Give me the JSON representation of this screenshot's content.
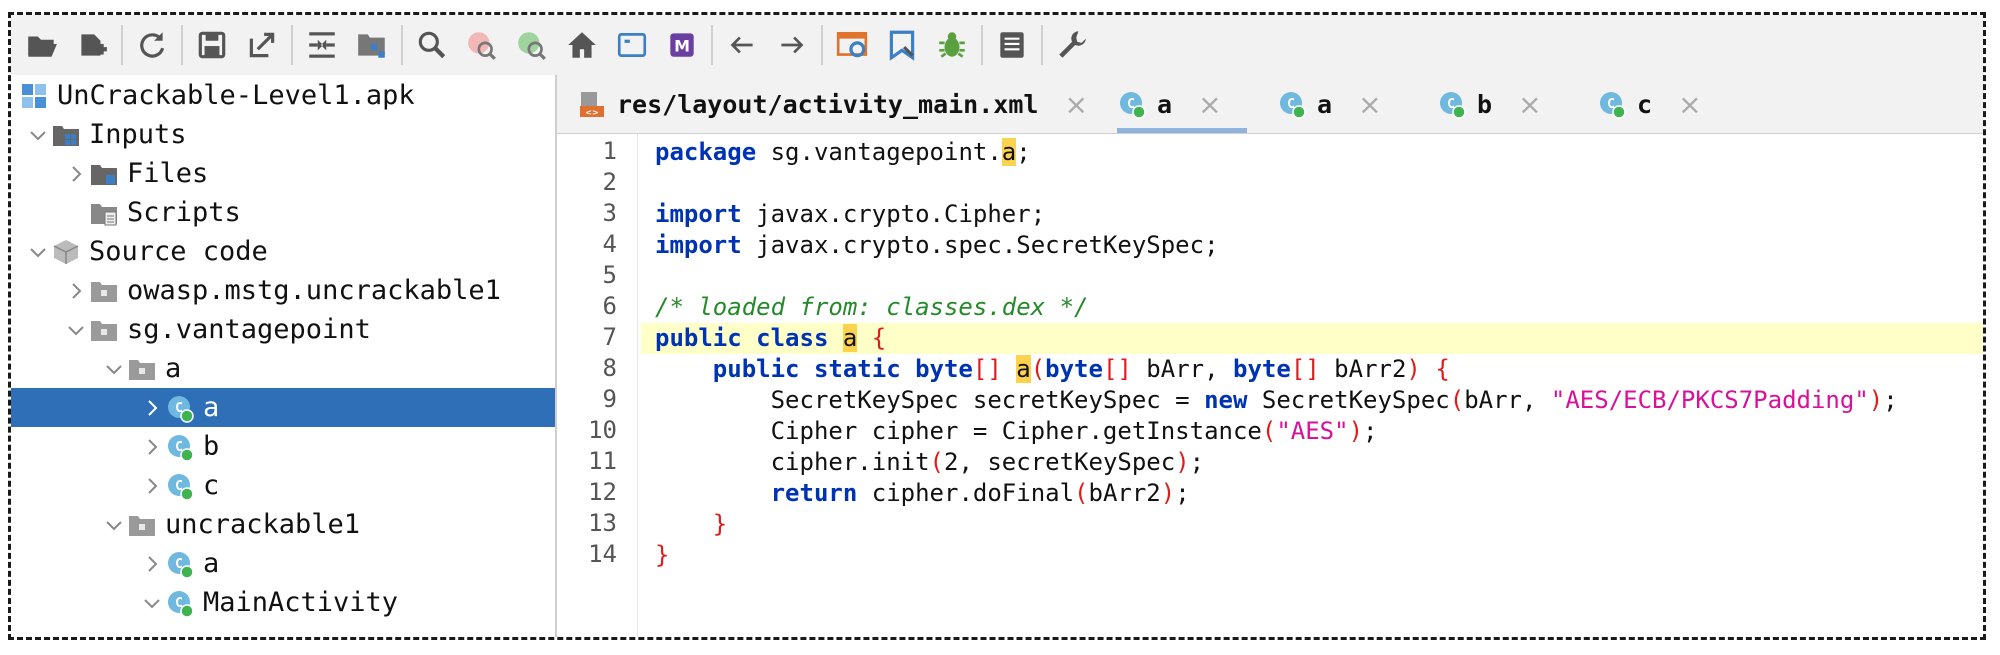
{
  "toolbar": {
    "buttons": [
      {
        "name": "open-file-icon"
      },
      {
        "name": "add-files-icon"
      },
      "sep",
      {
        "name": "reload-icon"
      },
      "sep",
      {
        "name": "save-icon"
      },
      {
        "name": "export-icon"
      },
      "sep",
      {
        "name": "sync-tree-icon"
      },
      {
        "name": "flatten-packages-icon"
      },
      "sep",
      {
        "name": "search-icon"
      },
      {
        "name": "find-class-icon"
      },
      {
        "name": "find-usage-icon"
      },
      {
        "name": "home-icon"
      },
      {
        "name": "log-viewer-icon"
      },
      {
        "name": "smali-icon"
      },
      "sep",
      {
        "name": "back-arrow-icon"
      },
      {
        "name": "forward-arrow-icon"
      },
      "sep",
      {
        "name": "deobfuscation-icon"
      },
      {
        "name": "quark-icon"
      },
      {
        "name": "debug-bug-icon"
      },
      "sep",
      {
        "name": "log-list-icon"
      },
      "sep",
      {
        "name": "wrench-settings-icon"
      }
    ]
  },
  "tree": {
    "rows": [
      {
        "label": "UnCrackable-Level1.apk",
        "indent": 0,
        "chev": "none",
        "icon": "apk",
        "selected": false
      },
      {
        "label": "Inputs",
        "indent": 0,
        "chev": "down",
        "icon": "inputs",
        "selected": false
      },
      {
        "label": "Files",
        "indent": 1,
        "chev": "right",
        "icon": "folder-dark",
        "selected": false
      },
      {
        "label": "Scripts",
        "indent": 1,
        "chev": "none",
        "icon": "scripts",
        "selected": false
      },
      {
        "label": "Source code",
        "indent": 0,
        "chev": "down",
        "icon": "box",
        "selected": false
      },
      {
        "label": "owasp.mstg.uncrackable1",
        "indent": 1,
        "chev": "right",
        "icon": "package",
        "selected": false
      },
      {
        "label": "sg.vantagepoint",
        "indent": 1,
        "chev": "down",
        "icon": "package",
        "selected": false
      },
      {
        "label": "a",
        "indent": 2,
        "chev": "down",
        "icon": "package",
        "selected": false
      },
      {
        "label": "a",
        "indent": 3,
        "chev": "right",
        "icon": "class",
        "selected": true
      },
      {
        "label": "b",
        "indent": 3,
        "chev": "right",
        "icon": "class",
        "selected": false
      },
      {
        "label": "c",
        "indent": 3,
        "chev": "right",
        "icon": "class",
        "selected": false
      },
      {
        "label": "uncrackable1",
        "indent": 2,
        "chev": "down",
        "icon": "package",
        "selected": false
      },
      {
        "label": "a",
        "indent": 3,
        "chev": "right",
        "icon": "class",
        "selected": false
      },
      {
        "label": "MainActivity",
        "indent": 3,
        "chev": "down",
        "icon": "class",
        "selected": false
      }
    ]
  },
  "tabs": [
    {
      "label": "res/layout/activity_main.xml",
      "icon": "xml",
      "active": false,
      "close": "×"
    },
    {
      "label": "a",
      "icon": "class",
      "active": true,
      "close": "×"
    },
    {
      "label": "a",
      "icon": "class",
      "active": false,
      "close": "×"
    },
    {
      "label": "b",
      "icon": "class",
      "active": false,
      "close": "×"
    },
    {
      "label": "c",
      "icon": "class",
      "active": false,
      "close": "×"
    }
  ],
  "editor": {
    "highlight_line": 7,
    "lines": [
      [
        [
          "kw",
          "package"
        ],
        [
          "t",
          " sg.vantagepoint."
        ],
        [
          "mark",
          "a"
        ],
        [
          "t",
          ";"
        ]
      ],
      [],
      [
        [
          "kw",
          "import"
        ],
        [
          "t",
          " javax.crypto.Cipher;"
        ]
      ],
      [
        [
          "kw",
          "import"
        ],
        [
          "t",
          " javax.crypto.spec.SecretKeySpec;"
        ]
      ],
      [],
      [
        [
          "cm",
          "/* loaded from: classes.dex */"
        ]
      ],
      [
        [
          "kw",
          "public class "
        ],
        [
          "mark",
          "a"
        ],
        [
          "t",
          " "
        ],
        [
          "br",
          "{"
        ]
      ],
      [
        [
          "t",
          "    "
        ],
        [
          "kw",
          "public static byte"
        ],
        [
          "br",
          "[]"
        ],
        [
          "t",
          " "
        ],
        [
          "mark",
          "a"
        ],
        [
          "br",
          "("
        ],
        [
          "kw",
          "byte"
        ],
        [
          "br",
          "[]"
        ],
        [
          "t",
          " bArr, "
        ],
        [
          "kw",
          "byte"
        ],
        [
          "br",
          "[]"
        ],
        [
          "t",
          " bArr2"
        ],
        [
          "br",
          ")"
        ],
        [
          "t",
          " "
        ],
        [
          "br",
          "{"
        ]
      ],
      [
        [
          "t",
          "        SecretKeySpec secretKeySpec = "
        ],
        [
          "kw",
          "new"
        ],
        [
          "t",
          " SecretKeySpec"
        ],
        [
          "br",
          "("
        ],
        [
          "t",
          "bArr, "
        ],
        [
          "str",
          "\"AES/ECB/PKCS7Padding\""
        ],
        [
          "br",
          ")"
        ],
        [
          "t",
          ";"
        ]
      ],
      [
        [
          "t",
          "        Cipher cipher = Cipher.getInstance"
        ],
        [
          "br",
          "("
        ],
        [
          "str",
          "\"AES\""
        ],
        [
          "br",
          ")"
        ],
        [
          "t",
          ";"
        ]
      ],
      [
        [
          "t",
          "        cipher.init"
        ],
        [
          "br",
          "("
        ],
        [
          "t",
          "2, secretKeySpec"
        ],
        [
          "br",
          ")"
        ],
        [
          "t",
          ";"
        ]
      ],
      [
        [
          "t",
          "        "
        ],
        [
          "kw",
          "return"
        ],
        [
          "t",
          " cipher.doFinal"
        ],
        [
          "br",
          "("
        ],
        [
          "t",
          "bArr2"
        ],
        [
          "br",
          ")"
        ],
        [
          "t",
          ";"
        ]
      ],
      [
        [
          "t",
          "    "
        ],
        [
          "br",
          "}"
        ]
      ],
      [
        [
          "br",
          "}"
        ]
      ]
    ]
  },
  "colors": {
    "selection": "#2e6fb7",
    "keyword": "#0033b3",
    "string": "#d6119a",
    "comment": "#268a2c",
    "bracket": "#e01b1b",
    "highlight": "#ffffc8",
    "mark": "#fcd34d"
  }
}
